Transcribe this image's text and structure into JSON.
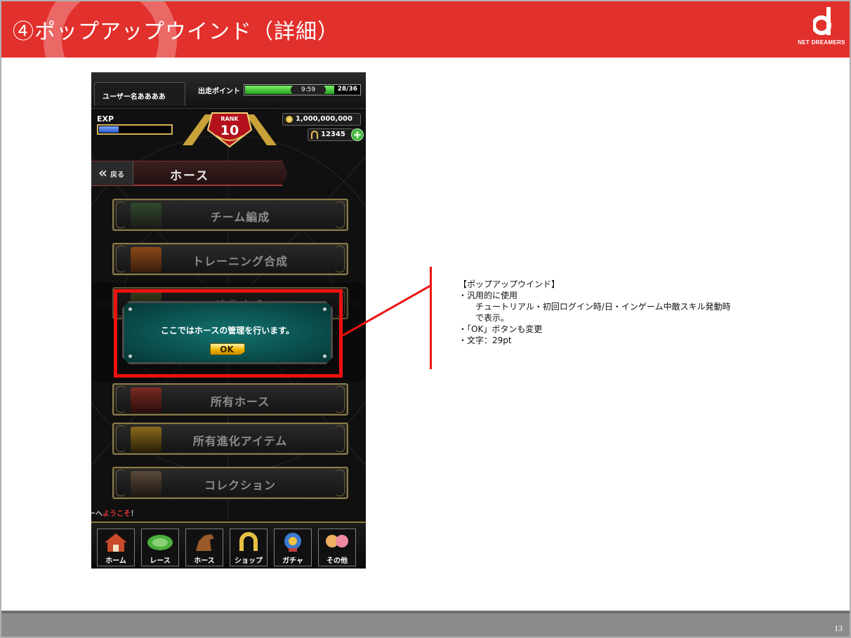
{
  "slide": {
    "title": "④ポップアップウインド（詳細）",
    "logo_text": "NET DREAMERS",
    "page_number": "13",
    "brand_color": "#e2302c"
  },
  "game": {
    "status": {
      "username": "ユーザー名ああああ",
      "stamina_label": "出走ポイント",
      "stamina_timer": "9:59",
      "stamina_count": "28/36",
      "stamina_fraction": 0.78,
      "exp_label": "EXP",
      "exp_fraction": 0.28,
      "rank_label": "RANK",
      "rank_value": "10",
      "gold": "1,000,000,000",
      "horseshoes": "12345",
      "plus_label": "+"
    },
    "nav": {
      "back_label": "戻る",
      "section_title": "ホース"
    },
    "menu": [
      {
        "label": "チーム編成",
        "icon": "team-thumbnail"
      },
      {
        "label": "トレーニング合成",
        "icon": "training-thumbnail"
      },
      {
        "label": "進化合成",
        "icon": "evolution-thumbnail"
      },
      {
        "label": "所有ホース",
        "icon": "barn-thumbnail"
      },
      {
        "label": "所有進化アイテム",
        "icon": "trophy-thumbnail"
      },
      {
        "label": "コレクション",
        "icon": "collection-thumbnail"
      }
    ],
    "popup": {
      "message": "ここではホースの管理を行います。",
      "ok_label": "OK"
    },
    "ticker": {
      "prefix": "ーへ",
      "highlight": "ようこそ",
      "suffix": "！"
    },
    "tabs": [
      {
        "label": "ホーム",
        "icon": "home-icon"
      },
      {
        "label": "レース",
        "icon": "race-track-icon"
      },
      {
        "label": "ホース",
        "icon": "horse-icon"
      },
      {
        "label": "ショップ",
        "icon": "horseshoe-icon"
      },
      {
        "label": "ガチャ",
        "icon": "gacha-icon"
      },
      {
        "label": "その他",
        "icon": "others-icon"
      }
    ]
  },
  "notes": {
    "heading": "【ポップアップウインド】",
    "line1": "・汎用的に使用",
    "line2": "チュートリアル・初回ログイン時/日・インゲーム中敵スキル発動時",
    "line3": "で表示。",
    "line4": "・「OK」ボタンも変更",
    "line5": "・文字：29pt"
  }
}
